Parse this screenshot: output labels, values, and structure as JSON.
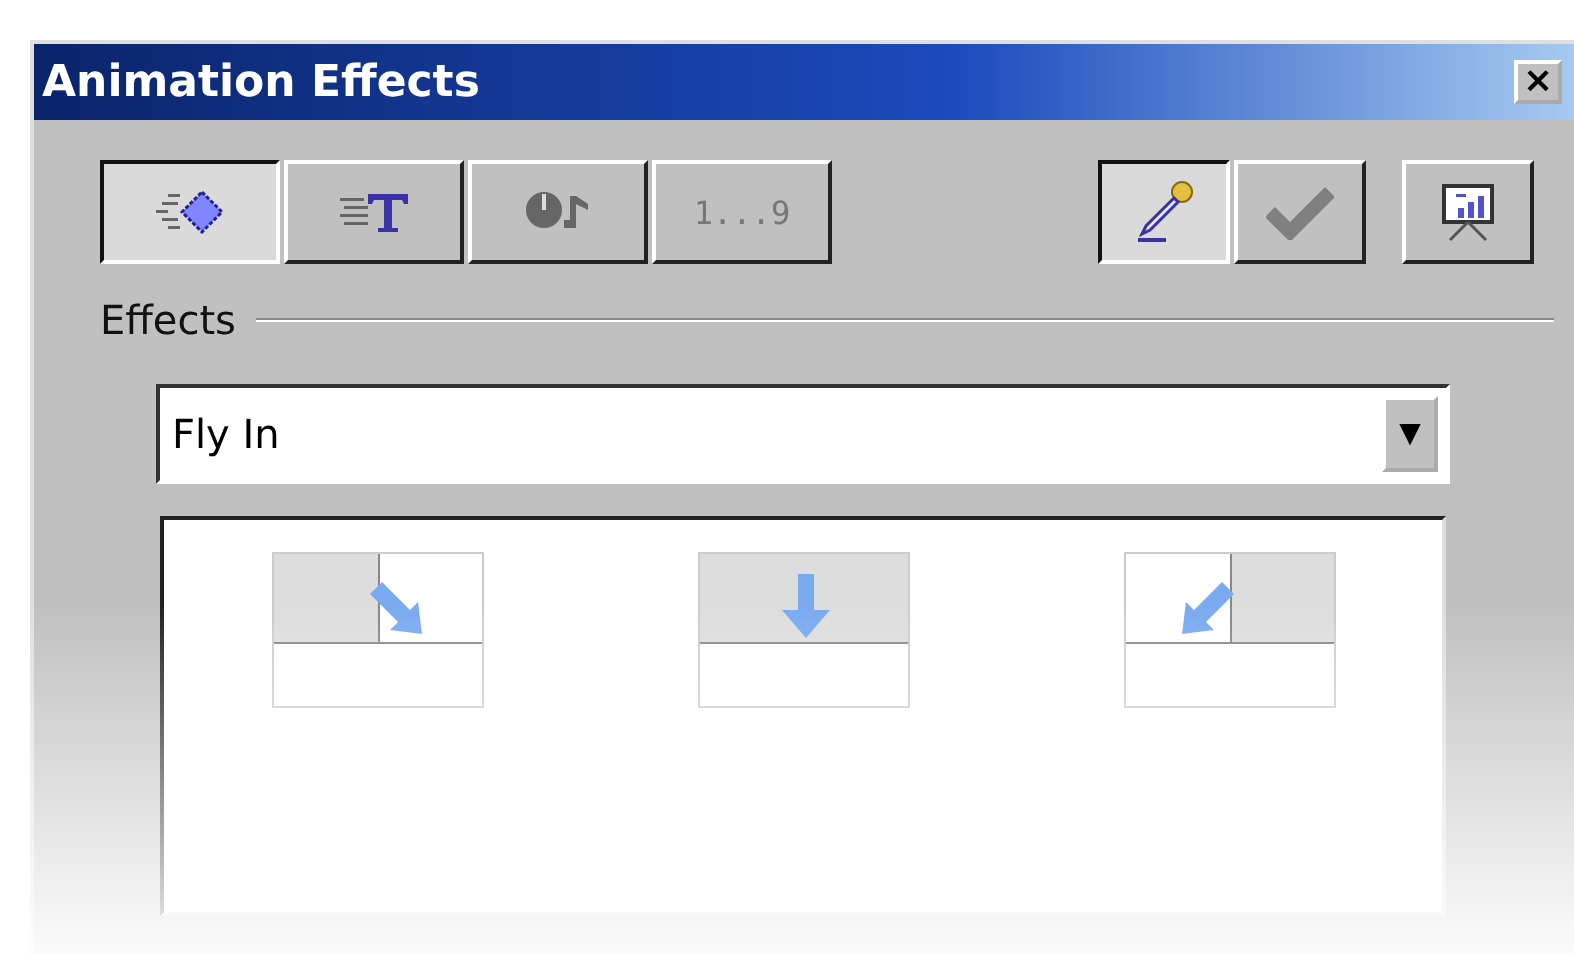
{
  "window": {
    "title": "Animation Effects",
    "close": "×"
  },
  "tabs": [
    {
      "kind": "effect",
      "selected": true
    },
    {
      "kind": "text",
      "selected": false
    },
    {
      "kind": "sound",
      "selected": false
    },
    {
      "kind": "order",
      "label": "1...9",
      "selected": false
    }
  ],
  "tools": [
    {
      "kind": "pen",
      "pressed": true
    },
    {
      "kind": "check",
      "pressed": false
    },
    {
      "kind": "preview",
      "pressed": false
    }
  ],
  "effects": {
    "label": "Effects",
    "dropdown": {
      "value": "Fly In",
      "arrow": "▼"
    },
    "tiles": [
      {
        "kind": "down-right"
      },
      {
        "kind": "down"
      },
      {
        "kind": "down-left"
      }
    ]
  }
}
